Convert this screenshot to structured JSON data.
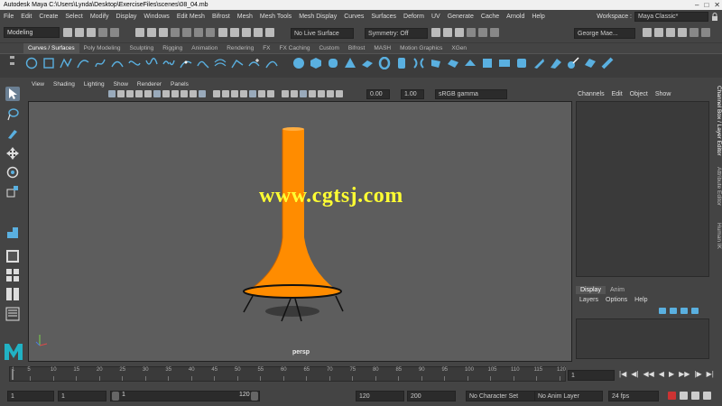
{
  "window": {
    "title": "Autodesk Maya  C:\\Users\\Lynda\\Desktop\\ExerciseFiles\\scenes\\08_04.mb",
    "controls": [
      "–",
      "□",
      "✕"
    ]
  },
  "menubar": [
    "File",
    "Edit",
    "Create",
    "Select",
    "Modify",
    "Display",
    "Windows",
    "Edit Mesh",
    "Bifrost",
    "Mesh",
    "Mesh Tools",
    "Mesh Display",
    "Curves",
    "Surfaces",
    "Deform",
    "UV",
    "Generate",
    "Cache",
    "Arnold",
    "Help"
  ],
  "workspace": {
    "label": "Workspace :",
    "value": "Maya Classic*"
  },
  "statusline": {
    "menuset": "Modeling",
    "live_surface": "No Live Surface",
    "symmetry": "Symmetry: Off",
    "user": "George Mae..."
  },
  "shelf": {
    "tabs": [
      "Curves / Surfaces",
      "Poly Modeling",
      "Sculpting",
      "Rigging",
      "Animation",
      "Rendering",
      "FX",
      "FX Caching",
      "Custom",
      "Bifrost",
      "MASH",
      "Motion Graphics",
      "XGen"
    ],
    "active_tab": "Curves / Surfaces"
  },
  "viewport": {
    "menus": [
      "View",
      "Shading",
      "Lighting",
      "Show",
      "Renderer",
      "Panels"
    ],
    "near_clip": "0.00",
    "far_clip": "1.00",
    "color_space": "sRGB gamma",
    "camera_label": "persp",
    "watermark": "www.cgtsj.com",
    "colors": {
      "object": "#ff8c00",
      "background": "#5d5d5d"
    }
  },
  "channel_box": {
    "menus": [
      "Channels",
      "Edit",
      "Object",
      "Show"
    ],
    "layer_tabs": [
      "Display",
      "Anim"
    ],
    "layer_menus": [
      "Layers",
      "Options",
      "Help"
    ],
    "side_tabs": [
      "Channel Box / Layer Editor",
      "Attribute Editor",
      "Human IK"
    ]
  },
  "timeline": {
    "ticks": [
      "5",
      "10",
      "15",
      "20",
      "25",
      "30",
      "35",
      "40",
      "45",
      "50",
      "55",
      "60",
      "65",
      "70",
      "75",
      "80",
      "85",
      "90",
      "95",
      "100",
      "105",
      "110",
      "115",
      "120"
    ],
    "start_tick": "1",
    "current_frame": "1",
    "playback": [
      "|◀",
      "◀|",
      "◀◀",
      "◀",
      "▶",
      "▶▶",
      "|▶",
      "▶|"
    ]
  },
  "range": {
    "start": "1",
    "playback_start": "1",
    "slider_start": "1",
    "slider_end": "120",
    "playback_end": "120",
    "end": "200",
    "character_set": "No Character Set",
    "anim_layer": "No Anim Layer",
    "fps": "24 fps"
  }
}
